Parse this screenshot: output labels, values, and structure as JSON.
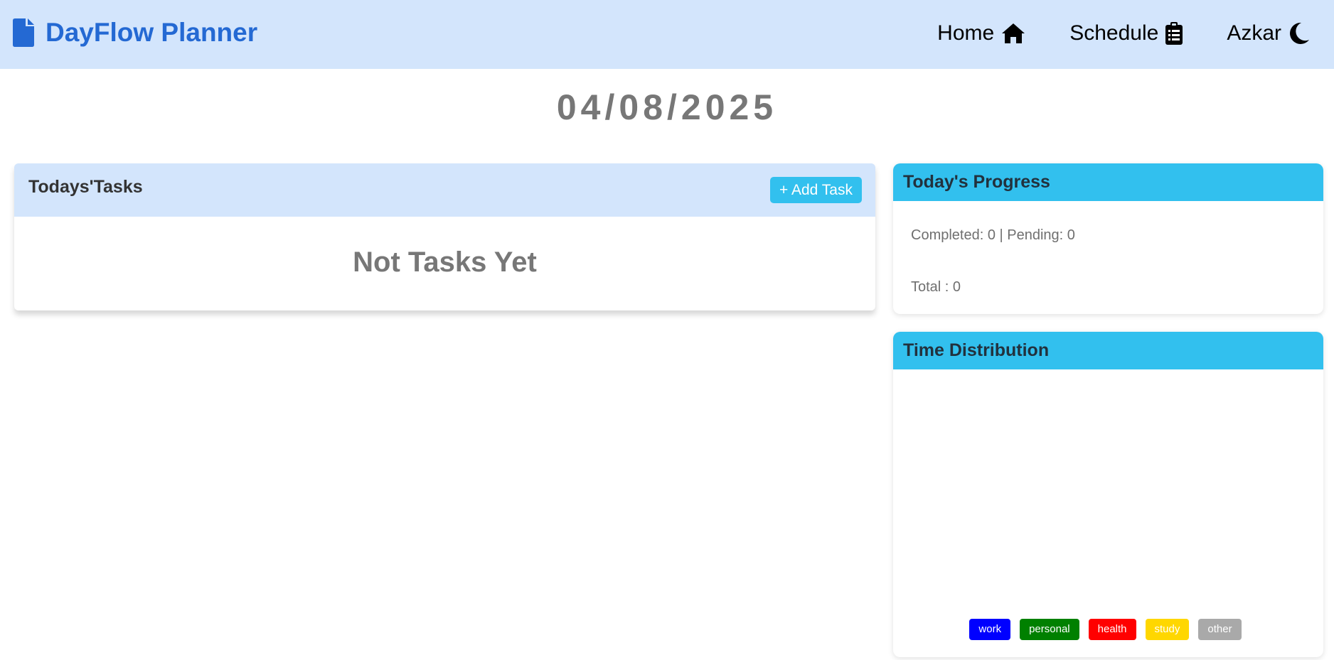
{
  "navbar": {
    "brand_icon": "file-icon",
    "brand_title": "DayFlow Planner",
    "brand_color": "#2469d3",
    "background": "#d3e5fc",
    "links": [
      {
        "label": "Home",
        "icon": "home-icon"
      },
      {
        "label": "Schedule",
        "icon": "clipboard-icon"
      },
      {
        "label": "Azkar",
        "icon": "moon-icon"
      }
    ]
  },
  "date": "04/08/2025",
  "tasks": {
    "title": "Todays'Tasks",
    "add_label": "+ Add Task",
    "empty_message": "Not Tasks Yet",
    "accent": "#32c0ee"
  },
  "progress": {
    "title": "Today's Progress",
    "status_line": "Completed: 0 | Pending: 0",
    "total_line": "Total : 0"
  },
  "distribution": {
    "title": "Time Distribution",
    "legend": [
      {
        "label": "work",
        "color": "#0000ff"
      },
      {
        "label": "personal",
        "color": "#008000"
      },
      {
        "label": "health",
        "color": "#ff0000"
      },
      {
        "label": "study",
        "color": "#ffd700"
      },
      {
        "label": "other",
        "color": "#a9a9a9"
      }
    ]
  }
}
